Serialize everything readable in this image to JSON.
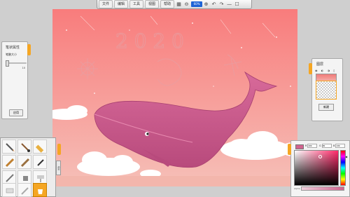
{
  "menu": {
    "items": [
      "文件",
      "编辑",
      "工具",
      "视图",
      "帮助"
    ],
    "zoom": "60%"
  },
  "brush_panel": {
    "title": "笔状属性",
    "size_label": "笔触大小",
    "size_value": "10",
    "apply": "应用"
  },
  "layers": {
    "title": "图层",
    "icons": "◉ ◐ ◑ ▯",
    "button": "新建"
  },
  "color": {
    "r_label": "R",
    "r": "209",
    "g_label": "G",
    "g": "99",
    "b_label": "B",
    "b": "139",
    "swatch": "#d1638f",
    "alpha_label": "Alpha"
  },
  "tools": [
    "pencil",
    "brush",
    "marker",
    "crayon",
    "eraser",
    "ink-pen",
    "airbrush",
    "spray",
    "roller",
    "tube",
    "knife",
    "bucket"
  ],
  "canvas": {
    "sky_top": "#f87c7c",
    "sky_bottom": "#f6c0b8",
    "whale_color": "#d1638f"
  },
  "side_tab": "颜料"
}
